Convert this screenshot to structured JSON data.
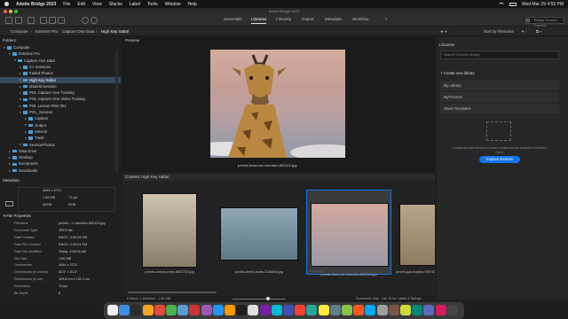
{
  "menubar": {
    "app": "Adobe Bridge 2023",
    "items": [
      "File",
      "Edit",
      "View",
      "Stacks",
      "Label",
      "Tools",
      "Window",
      "Help"
    ],
    "clock": "Wed Mar 29  4:55 PM"
  },
  "window": {
    "title": "Adobe Bridge 2023"
  },
  "toolbar": {
    "workspaces": [
      "Essentials",
      "Libraries",
      "Filmstrip",
      "Output",
      "Metadata",
      "Workflow"
    ],
    "active_workspace": "Libraries",
    "search_placeholder": "Bridge Search: Current"
  },
  "pathbar": {
    "crumbs": [
      "Computer",
      "Extreme Pro",
      "Capture One Data",
      "High Key Safari"
    ],
    "sort": "Sort by Filename"
  },
  "folders": {
    "header": "Folders",
    "items": [
      {
        "label": "Computer",
        "indent": 0,
        "open": true
      },
      {
        "label": "Extreme Pro",
        "indent": 1,
        "open": true
      },
      {
        "label": "Capture One Data",
        "indent": 2,
        "open": true
      },
      {
        "label": "C1 Sessions",
        "indent": 3,
        "open": false
      },
      {
        "label": "Faded Photos",
        "indent": 3,
        "open": false
      },
      {
        "label": "High Key Safari",
        "indent": 3,
        "open": false,
        "selected": true
      },
      {
        "label": "Modeld Session",
        "indent": 3,
        "open": false
      },
      {
        "label": "POL Capture One Training",
        "indent": 3,
        "open": false
      },
      {
        "label": "POL Capture One Video Training",
        "indent": 3,
        "open": false
      },
      {
        "label": "POL Lesson Plan 001",
        "indent": 3,
        "open": false
      },
      {
        "label": "POL_Session",
        "indent": 3,
        "open": true
      },
      {
        "label": "Capture",
        "indent": 4,
        "open": false
      },
      {
        "label": "Output",
        "indent": 4,
        "open": false
      },
      {
        "label": "Selects",
        "indent": 4,
        "open": false
      },
      {
        "label": "Trash",
        "indent": 4,
        "open": false
      },
      {
        "label": "SessionPhotos",
        "indent": 3,
        "open": false
      },
      {
        "label": "Data Drive",
        "indent": 1,
        "open": false
      },
      {
        "label": "Desktop",
        "indent": 1,
        "open": false
      },
      {
        "label": "Documents",
        "indent": 1,
        "open": false
      },
      {
        "label": "Downloads",
        "indent": 1,
        "open": false
      }
    ]
  },
  "metadata": {
    "header": "Metadata",
    "quick": {
      "dims": "4644 x 3712",
      "size": "1.56 MB",
      "res": "72 ppi",
      "color": "sRGB",
      "mode": "RGB"
    },
    "section": "File Properties",
    "rows": [
      {
        "k": "Filename",
        "v": "pexels-...n-heerden-802112.jpg"
      },
      {
        "k": "Document Type",
        "v": "JPEG file"
      },
      {
        "k": "Date Created",
        "v": "5/8/22, 4:33:34 PM"
      },
      {
        "k": "Date File Created",
        "v": "5/8/22, 4:33:34 PM"
      },
      {
        "k": "Date File Modified",
        "v": "Today, 4:44:06 AM"
      },
      {
        "k": "File Size",
        "v": "1.56 MB"
      },
      {
        "k": "Dimensions",
        "v": "4644 x 3712"
      },
      {
        "k": "Dimensions (in inches)",
        "v": "64.5\" x 51.6\""
      },
      {
        "k": "Dimensions (in cm)",
        "v": "163.8 cm x 131.0 cm"
      },
      {
        "k": "Resolution",
        "v": "72 ppi"
      },
      {
        "k": "Bit Depth",
        "v": "8"
      }
    ]
  },
  "preview": {
    "header": "Preview",
    "caption": "pexels-frans-van-heerden-802112.jpg"
  },
  "content": {
    "header": "Content: High Key Safari",
    "thumbs": [
      {
        "file": "pexels-antony-trivet-6657225.jpg"
      },
      {
        "file": "pexels-derek-keats-3184848.jpg"
      },
      {
        "file": "pexels-frans-van-heerden-802112.jpg",
        "selected": true,
        "stars": "☆☆☆☆☆"
      },
      {
        "file": "pexels-gal-shapira-9557811.jpg"
      }
    ],
    "status": "6 items, 1 selected - 1.56 MB",
    "footer_options": [
      "Thumbnails Only",
      "Use 30 for Labels & Ratings"
    ]
  },
  "libraries": {
    "header": "Libraries",
    "search_placeholder": "Search Current Library",
    "create": "Create new library",
    "items": [
      "My Library",
      "MyThemes",
      "Stock Templates"
    ],
    "empty_text": "Create and add libraries to share content across projects in Creative Cloud.",
    "button": "Explore libraries"
  },
  "colors": {
    "accent": "#1473e6",
    "selected_row": "#3a4a5e",
    "folder": "#4a9bd8"
  }
}
